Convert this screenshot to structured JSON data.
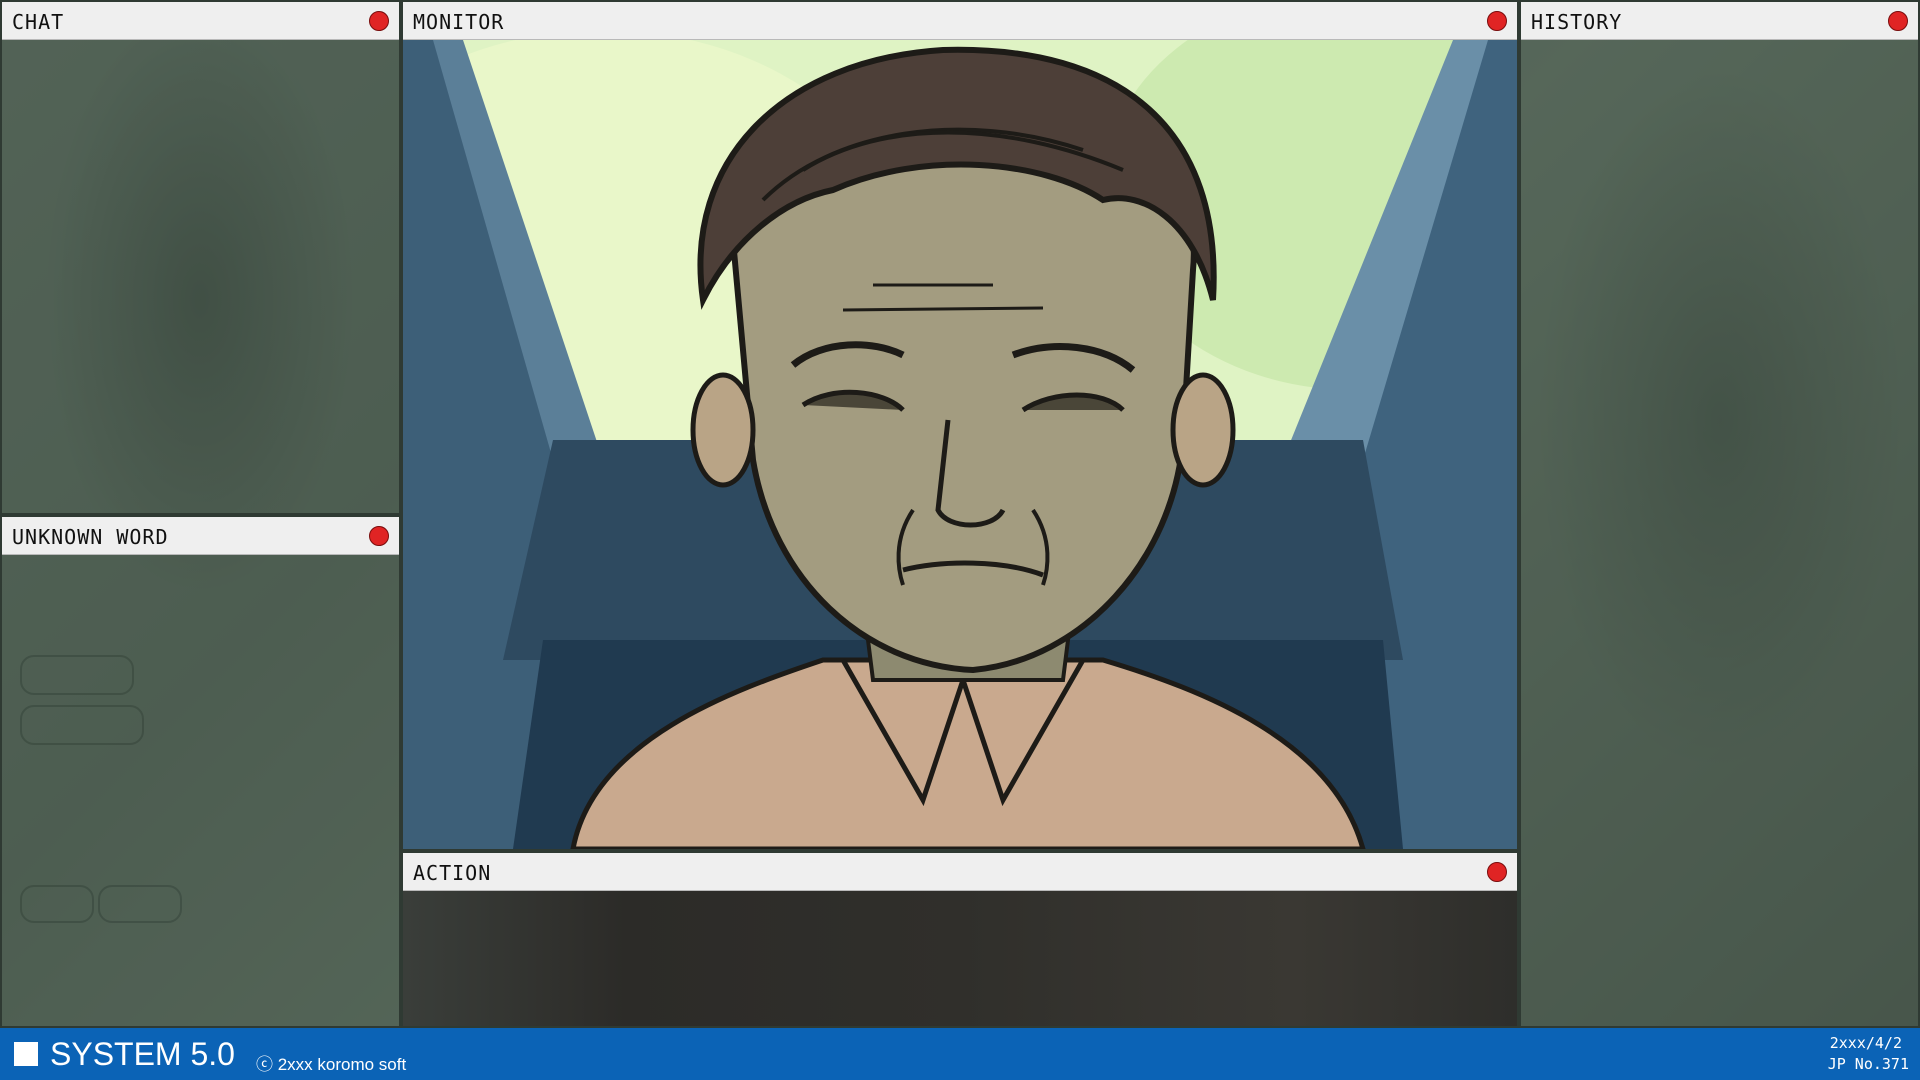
{
  "panels": {
    "chat": {
      "title": "CHAT"
    },
    "unknown_word": {
      "title": "UNKNOWN WORD"
    },
    "monitor": {
      "title": "MONITOR"
    },
    "action": {
      "title": "ACTION"
    },
    "history": {
      "title": "HISTORY"
    }
  },
  "taskbar": {
    "system_label": "SYSTEM 5.0",
    "copyright": "ⓒ 2xxx koromo soft",
    "date": "2xxx/4/2",
    "id": "JP No.371"
  },
  "colors": {
    "taskbar": "#0b63b6",
    "close_button": "#e02424",
    "header": "#efefef"
  }
}
